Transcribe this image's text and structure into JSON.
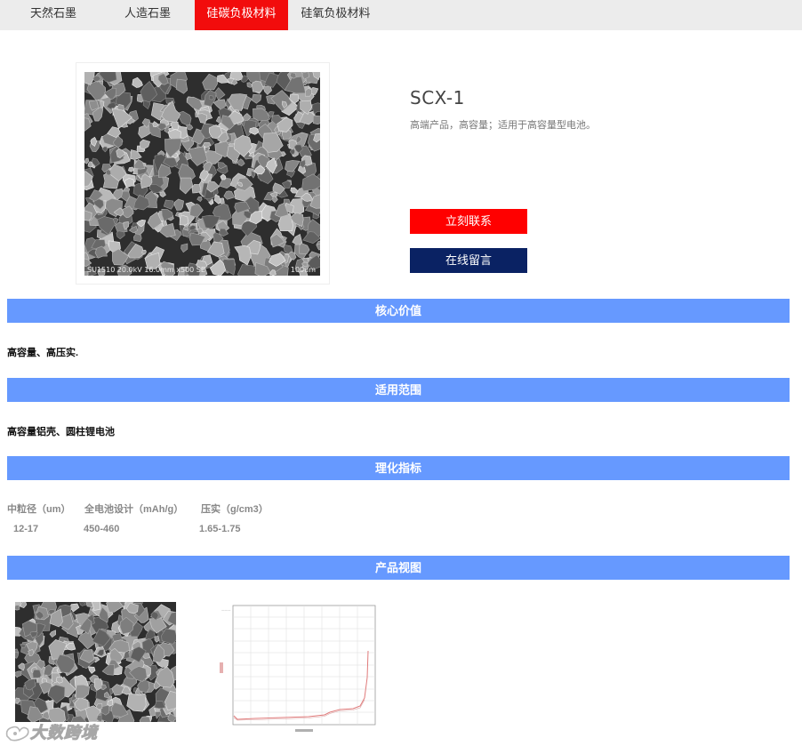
{
  "tabs": [
    {
      "label": "天然石墨",
      "active": false
    },
    {
      "label": "人造石墨",
      "active": false
    },
    {
      "label": "硅碳负极材料",
      "active": true
    },
    {
      "label": "硅氧负极材料",
      "active": false
    }
  ],
  "product": {
    "name": "SCX-1",
    "description": "高端产品，高容量；适用于高容量型电池。",
    "image_caption": "SU1510 20.0kV 16.0mm x500 SE",
    "image_scale": "100um"
  },
  "buttons": {
    "contact": "立刻联系",
    "message": "在线留言"
  },
  "sections": {
    "core_value": {
      "title": "核心价值",
      "text": "高容量、高压实."
    },
    "application": {
      "title": "适用范围",
      "text": "高容量铝壳、圆柱锂电池"
    },
    "specs": {
      "title": "理化指标",
      "headers": [
        "中粒径（um）",
        "全电池设计（mAh/g）",
        "压实（g/cm3）"
      ],
      "values": [
        "12-17",
        "450-460",
        "1.65-1.75"
      ]
    },
    "gallery": {
      "title": "产品视图"
    }
  },
  "watermark": {
    "text": "大数跨境"
  },
  "colors": {
    "tab_active": "#f20c0c",
    "section_bar": "#6699ff",
    "button_contact": "#ff0000",
    "button_message": "#0a2263"
  }
}
